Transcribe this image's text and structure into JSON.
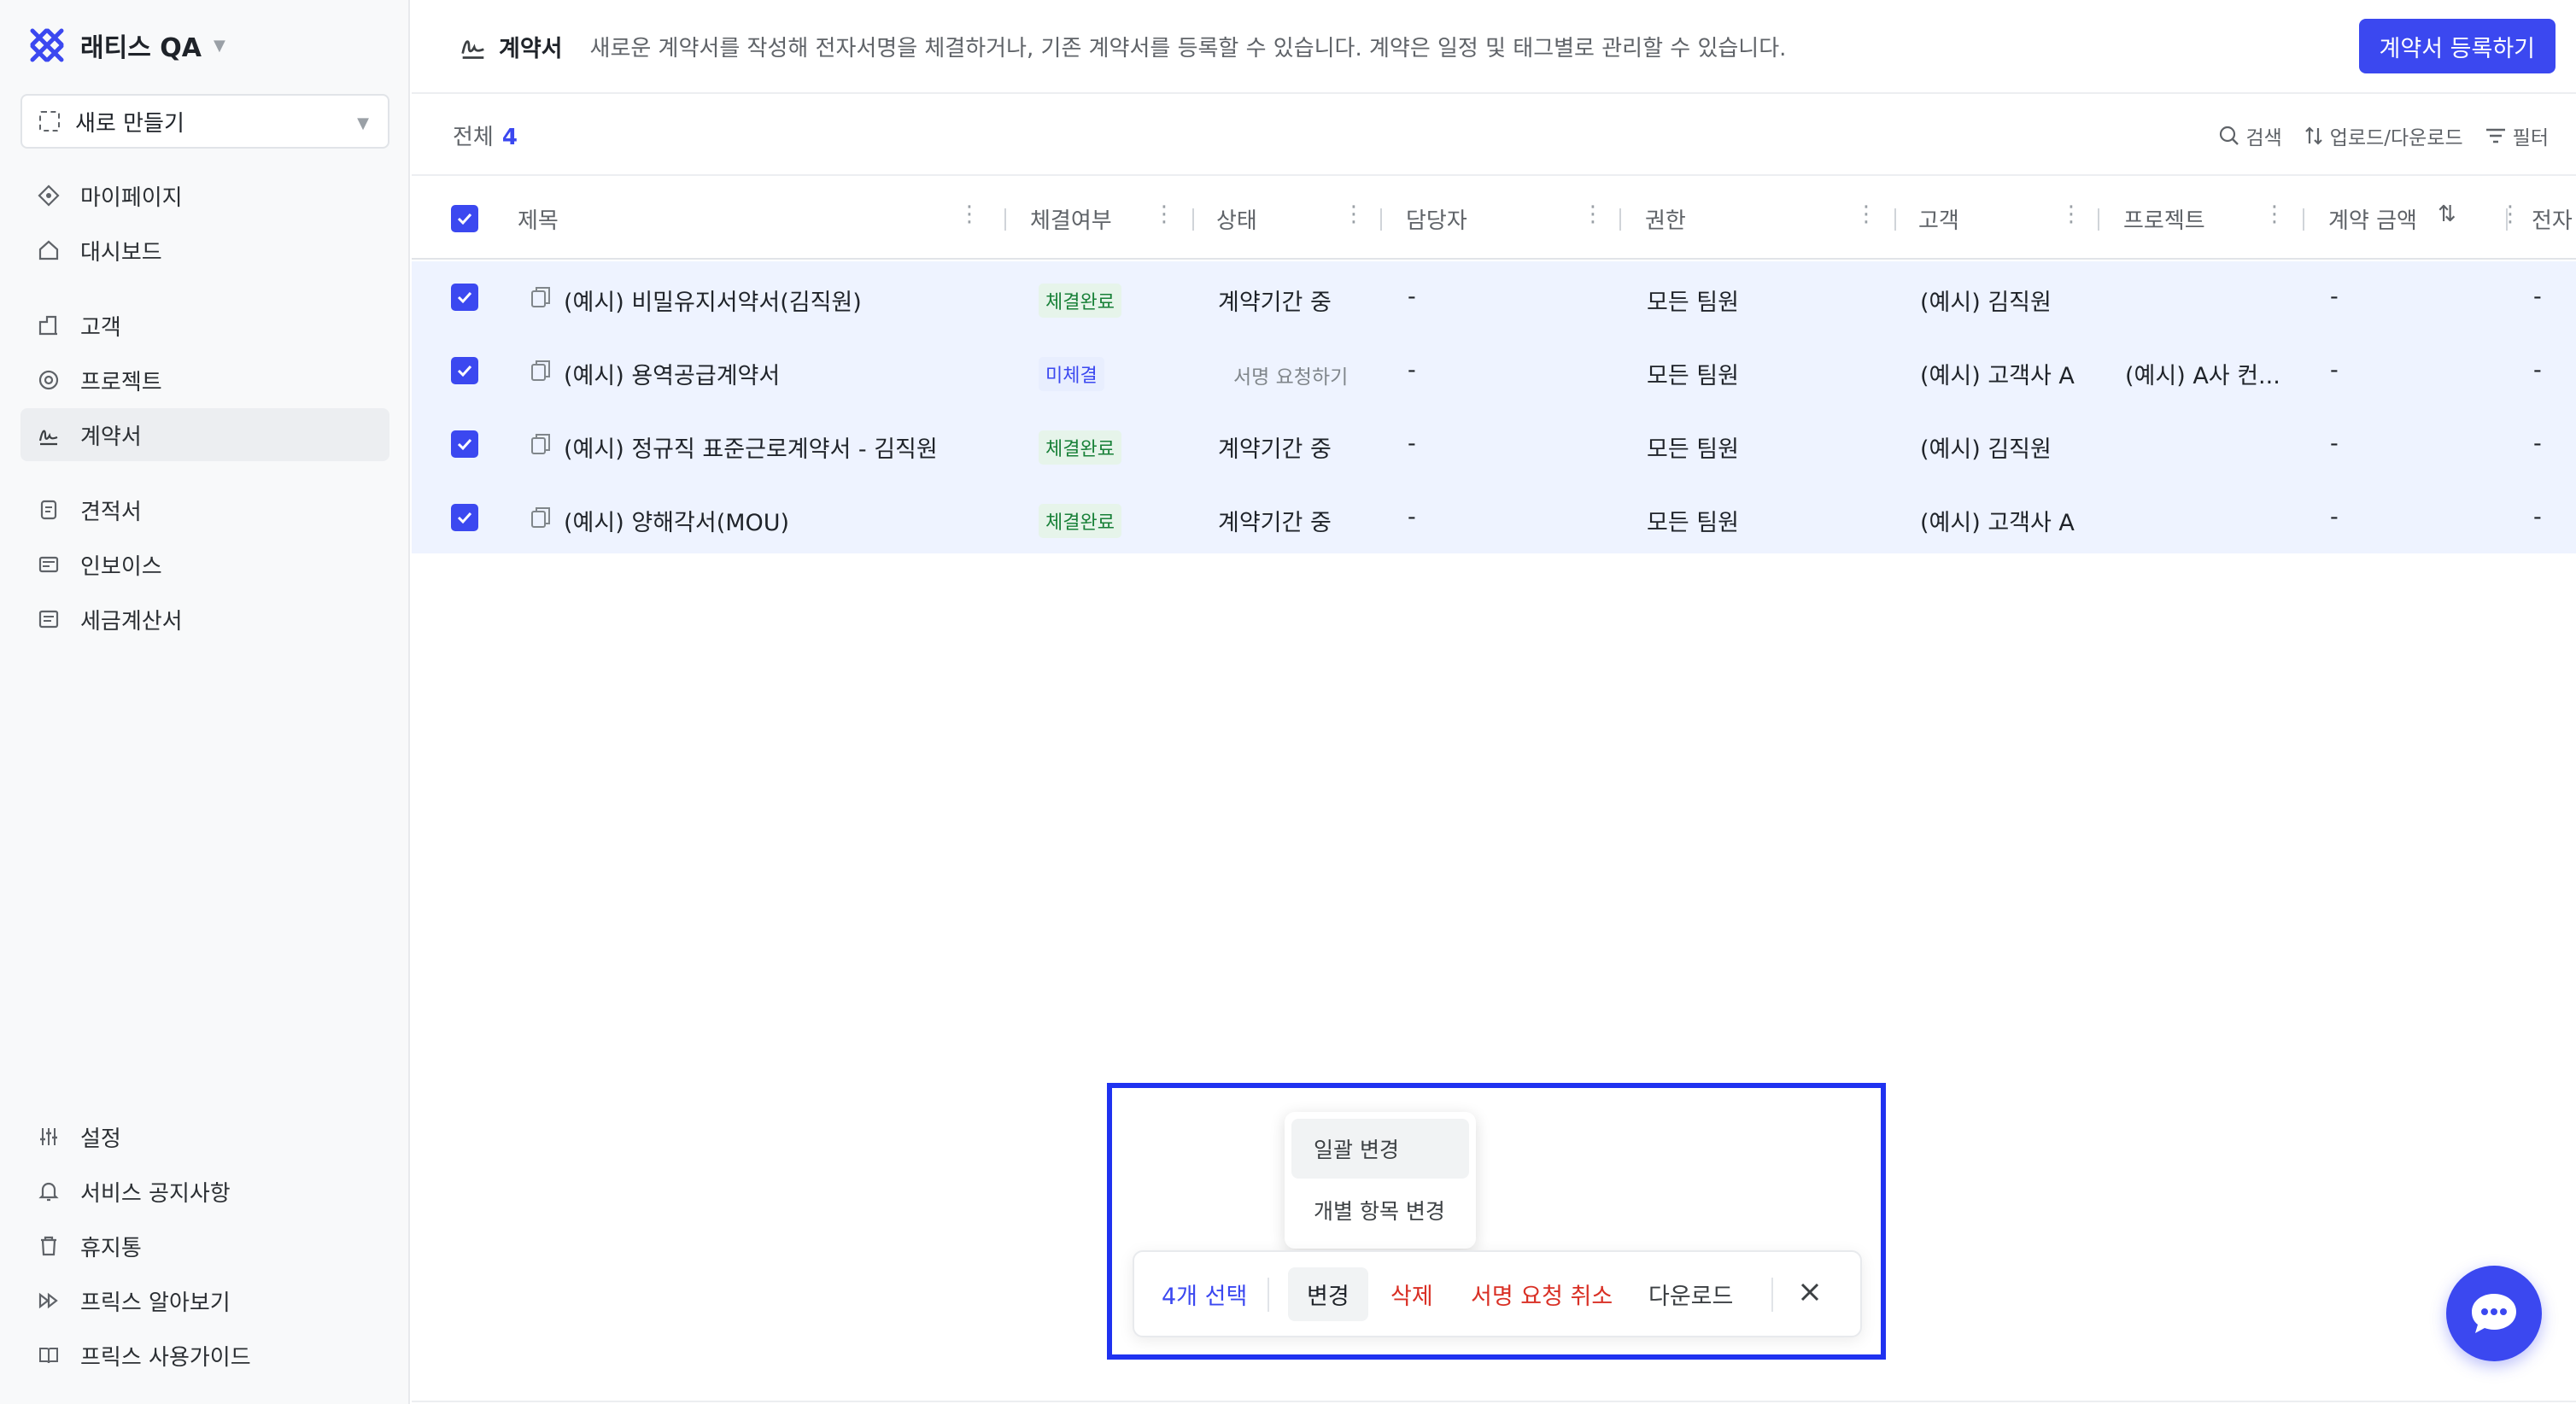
{
  "workspace": {
    "name": "래티스 QA"
  },
  "sidebar": {
    "create_label": "새로 만들기",
    "items": [
      {
        "label": "마이페이지",
        "icon": "diamond-icon"
      },
      {
        "label": "대시보드",
        "icon": "home-icon"
      },
      {
        "label": "고객",
        "icon": "building-icon"
      },
      {
        "label": "프로젝트",
        "icon": "target-icon"
      },
      {
        "label": "계약서",
        "icon": "signature-icon",
        "active": true
      },
      {
        "label": "견적서",
        "icon": "document-icon"
      },
      {
        "label": "인보이스",
        "icon": "invoice-icon"
      },
      {
        "label": "세금계산서",
        "icon": "receipt-icon"
      }
    ],
    "bottom_items": [
      {
        "label": "설정",
        "icon": "sliders-icon"
      },
      {
        "label": "서비스 공지사항",
        "icon": "bell-icon"
      },
      {
        "label": "휴지통",
        "icon": "trash-icon"
      },
      {
        "label": "프릭스 알아보기",
        "icon": "fast-forward-icon"
      },
      {
        "label": "프릭스 사용가이드",
        "icon": "book-icon"
      }
    ]
  },
  "header": {
    "title": "계약서",
    "description": "새로운 계약서를 작성해 전자서명을 체결하거나, 기존 계약서를 등록할 수 있습니다. 계약은 일정 및 태그별로 관리할 수 있습니다.",
    "register_button": "계약서 등록하기"
  },
  "toolbar": {
    "total_label": "전체",
    "total_count": "4",
    "search": "검색",
    "upload_download": "업로드/다운로드",
    "filter": "필터"
  },
  "table": {
    "columns": [
      "제목",
      "체결여부",
      "상태",
      "담당자",
      "권한",
      "고객",
      "프로젝트",
      "계약 금액",
      "전자"
    ],
    "rows": [
      {
        "title": "(예시) 비밀유지서약서(김직원)",
        "signed": "체결완료",
        "status": "계약기간 중",
        "manager": "-",
        "permission": "모든 팀원",
        "customer": "(예시) 김직원",
        "project": "",
        "amount": "-",
        "esign": "-"
      },
      {
        "title": "(예시) 용역공급계약서",
        "signed": "미체결",
        "status": "서명 요청하기",
        "manager": "-",
        "permission": "모든 팀원",
        "customer": "(예시) 고객사 A",
        "project": "(예시) A사 컨...",
        "amount": "-",
        "esign": "-"
      },
      {
        "title": "(예시) 정규직 표준근로계약서 - 김직원",
        "signed": "체결완료",
        "status": "계약기간 중",
        "manager": "-",
        "permission": "모든 팀원",
        "customer": "(예시) 김직원",
        "project": "",
        "amount": "-",
        "esign": "-"
      },
      {
        "title": "(예시) 양해각서(MOU)",
        "signed": "체결완료",
        "status": "계약기간 중",
        "manager": "-",
        "permission": "모든 팀원",
        "customer": "(예시) 고객사 A",
        "project": "",
        "amount": "-",
        "esign": "-"
      }
    ]
  },
  "dropdown": {
    "items": [
      "일괄 변경",
      "개별 항목 변경"
    ]
  },
  "actionbar": {
    "selected": "4개 선택",
    "change": "변경",
    "delete": "삭제",
    "cancel_sign": "서명 요청 취소",
    "download": "다운로드"
  },
  "colors": {
    "accent": "#3b48f0",
    "danger": "#d93025",
    "signed_bg": "#e6f4ea",
    "signed_text": "#188038",
    "selected_row": "#eef3ff",
    "highlight_frame": "#1f32f0"
  }
}
